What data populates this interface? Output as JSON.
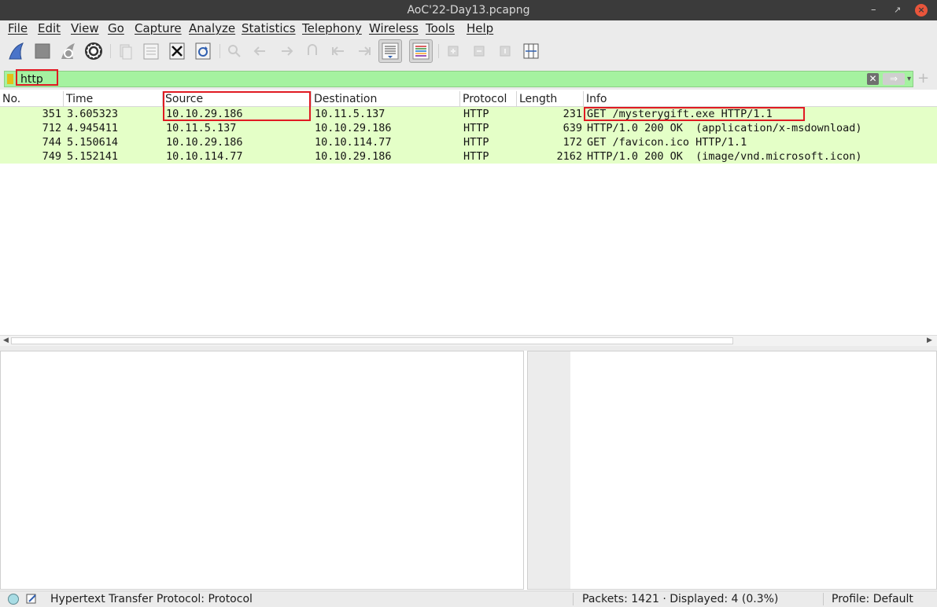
{
  "window": {
    "title": "AoC'22-Day13.pcapng",
    "minimize": "–",
    "maximize": "↗",
    "close": "×"
  },
  "menu": [
    "File",
    "Edit",
    "View",
    "Go",
    "Capture",
    "Analyze",
    "Statistics",
    "Telephony",
    "Wireless",
    "Tools",
    "Help"
  ],
  "toolbar": {
    "icons": [
      "start-capture-icon",
      "stop-capture-icon",
      "restart-capture-icon",
      "capture-options-icon",
      "open-file-icon",
      "save-file-icon",
      "close-file-icon",
      "reload-file-icon",
      "find-packet-icon",
      "go-back-icon",
      "go-forward-icon",
      "go-to-packet-icon",
      "first-packet-icon",
      "last-packet-icon",
      "auto-scroll-icon",
      "colorize-icon",
      "zoom-in-icon",
      "zoom-out-icon",
      "normal-size-icon",
      "resize-columns-icon"
    ]
  },
  "filter": {
    "value": "http",
    "clear": "✕",
    "apply": "⇒",
    "dropdown": "▾",
    "add": "+"
  },
  "columns": [
    "No.",
    "Time",
    "Source",
    "Destination",
    "Protocol",
    "Length",
    "Info"
  ],
  "packets": [
    {
      "no": "351",
      "time": "3.605323",
      "source": "10.10.29.186",
      "destination": "10.11.5.137",
      "protocol": "HTTP",
      "length": "231",
      "info": "GET /mysterygift.exe HTTP/1.1"
    },
    {
      "no": "712",
      "time": "4.945411",
      "source": "10.11.5.137",
      "destination": "10.10.29.186",
      "protocol": "HTTP",
      "length": "639",
      "info": "HTTP/1.0 200 OK  (application/x-msdownload)"
    },
    {
      "no": "744",
      "time": "5.150614",
      "source": "10.10.29.186",
      "destination": "10.10.114.77",
      "protocol": "HTTP",
      "length": "172",
      "info": "GET /favicon.ico HTTP/1.1"
    },
    {
      "no": "749",
      "time": "5.152141",
      "source": "10.10.114.77",
      "destination": "10.10.29.186",
      "protocol": "HTTP",
      "length": "2162",
      "info": "HTTP/1.0 200 OK  (image/vnd.microsoft.icon)"
    }
  ],
  "status": {
    "field": "Hypertext Transfer Protocol: Protocol",
    "packets": "Packets: 1421 · Displayed: 4 (0.3%)",
    "profile": "Profile: Default"
  },
  "colors": {
    "row_bg": "#e4ffc7",
    "filter_bg": "#a5f2a0",
    "highlight": "#e01a22"
  }
}
